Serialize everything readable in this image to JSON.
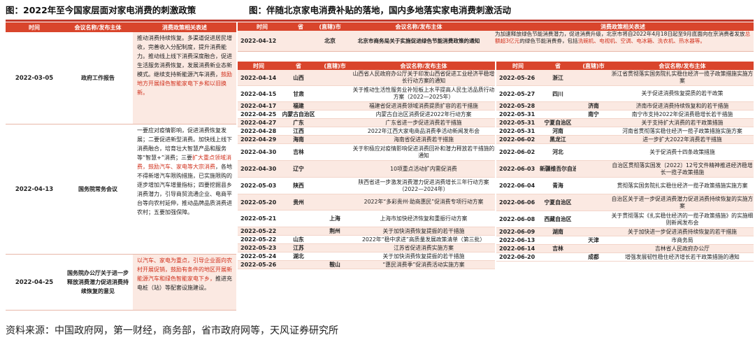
{
  "fig1_title": "图：2022年至今国家层面对家电消费的刺激政策",
  "fig2_title": "图：伴随北京家电消费补贴的落地，国内多地落实家电消费刺激活动",
  "left": {
    "headers": [
      "时间",
      "会议名称/发布主体",
      "消费政策相关表述"
    ],
    "rows": [
      {
        "date": "2022-03-05",
        "org": "政府工作报告",
        "text": "推动消费持续恢复。多渠道促进居民增收，完善收入分配制度，提升消费能力。推动线上线下消费深度融合，促进生活服务消费恢复，发展消费新业态新模式。继续支持新能源汽车消费，",
        "text_red": "鼓励地方开展绿色智能家电下乡和以旧换新。",
        "text_tail": ""
      },
      {
        "date": "2022-04-13",
        "org": "国务院常务会议",
        "text": "一要应对疫情影响，促进消费恢复发展；二要促进新型消费。加快线上线下消费融合，培育壮大智慧产品和服务等“智慧+”消费；三要",
        "text_red": "扩大重点领域消费，鼓励汽车、家电等大宗消费",
        "text_tail": "，各地不得新增汽车限购措施，已实施限购的逐步增加汽车增量指标；四要挖掘县乡消费潜力，引导商贸流通企业、电商平台等向农村延伸，推动品牌品质消费进农村；五要加强保障。"
      },
      {
        "date": "2022-04-25",
        "org": "国务院办公厅关于进一步释放消费潜力促进消费持续恢复的意见",
        "text": "",
        "text_red": "以汽车、家电为重点，引导企业面向农村开展促销，鼓励有条件的地区开展新能源汽车和绿色智能家电下乡，",
        "text_tail": "推进充电桩（站）等配套设施建设。"
      }
    ]
  },
  "right": {
    "top_headers": [
      "时间",
      "省",
      "(直辖)市",
      "会议名称/发布主体",
      "消费政策相关表述"
    ],
    "top_row": {
      "date": "2022-04-12",
      "city": "北京",
      "org": "北京市商务局关于实施促进绿色节能消费政策的通知",
      "text": "为加速释放绿色节能消费潜力，促进消费升级，北京市将自2022年4月18日起至9月底面向在京消费者发放",
      "text_red": "总额超3亿元",
      "text_mid": "的绿色节能消费券，包括",
      "text_red2": "洗碗机、电视机、空调、电冰箱、洗衣机、热水器等。",
      "text_tail": ""
    },
    "sub_headers": [
      "时间",
      "省",
      "(直辖)市",
      "会议名称/发布主体"
    ],
    "left_rows": [
      {
        "date": "2022-04-14",
        "prov": "山西",
        "city": "",
        "org": "山西省人民政府办公厅关于印发山西省促进工业经济平稳增长行动方案的通知"
      },
      {
        "date": "2022-04-15",
        "prov": "甘肃",
        "city": "",
        "org": "关于推动生活性服务业补短板上水平提高人民生活品质行动方案（2022—2025年）"
      },
      {
        "date": "2022-04-17",
        "prov": "福建",
        "city": "",
        "org": "福建省促进消费领域消费提质扩容的若干措施"
      },
      {
        "date": "2022-04-25",
        "prov": "内蒙古自治区",
        "city": "",
        "org": "内蒙古自治区消费促进2022年行动方案"
      },
      {
        "date": "2022-04-27",
        "prov": "广东",
        "city": "",
        "org": "广东省进一步促进消费若干措施"
      },
      {
        "date": "2022-04-28",
        "prov": "江西",
        "city": "",
        "org": "2022年江西大家电商品消费季活动新闻发布会"
      },
      {
        "date": "2022-04-29",
        "prov": "海南",
        "city": "",
        "org": "海南省促进消费若干措施"
      },
      {
        "date": "2022-04-30",
        "prov": "吉林",
        "city": "",
        "org": "关于积极应对疫情影响促进消费回补和潜力释放若干措施的通知"
      },
      {
        "date": "2022-04-30",
        "prov": "辽宁",
        "city": "",
        "org": "10项重点活动扩内需促消费"
      },
      {
        "date": "2022-05-03",
        "prov": "陕西",
        "city": "",
        "org": "陕西省进一步激发消费潜力促进消费增长三年行动方案（2022—2024年）"
      },
      {
        "date": "2022-05-20",
        "prov": "贵州",
        "city": "",
        "org": "2022年“多彩贵州·助商惠民”促消费专项行动方案"
      },
      {
        "date": "2022-05-21",
        "prov": "",
        "city": "上海",
        "org": "上海市加快经济恢复和重振行动方案"
      },
      {
        "date": "2022-05-22",
        "prov": "",
        "city": "荆州",
        "org": "关于加快消费恢复提振的若干措施"
      },
      {
        "date": "2022-05-22",
        "prov": "山东",
        "city": "",
        "org": "2022年“稳中求进”高质量发展政策清单（第三批）"
      },
      {
        "date": "2022-05-23",
        "prov": "江苏",
        "city": "",
        "org": "江苏省促进消费实施方案"
      },
      {
        "date": "2022-05-24",
        "prov": "湖北",
        "city": "",
        "org": "关于加快消费恢复提振的若干措施"
      },
      {
        "date": "2022-05-26",
        "prov": "",
        "city": "鞍山",
        "org": "“惠民消费季”促消费活动实施方案"
      }
    ],
    "right_rows": [
      {
        "date": "2022-05-26",
        "prov": "浙江",
        "city": "",
        "org": "浙江省贯彻落实国务院扎实稳住经济一揽子政策措施实施方案"
      },
      {
        "date": "2022-05-27",
        "prov": "四川",
        "city": "",
        "org": "关于促进消费恢复提质的若干政策"
      },
      {
        "date": "2022-05-28",
        "prov": "",
        "city": "济南",
        "org": "济南市促进消费持续恢复和的若干措施"
      },
      {
        "date": "2022-05-31",
        "prov": "",
        "city": "南宁",
        "org": "南宁市支持2022年促消费稳增长若干措施"
      },
      {
        "date": "2022-05-31",
        "prov": "宁夏自治区",
        "city": "",
        "org": "关于支持扩大消费的若干政策措施"
      },
      {
        "date": "2022-05-31",
        "prov": "河南",
        "city": "",
        "org": "河南省贯彻落实稳住经济一揽子政策措施实施方案"
      },
      {
        "date": "2022-06-02",
        "prov": "黑龙江",
        "city": "",
        "org": "进一步扩大2022年消费若干措施"
      },
      {
        "date": "2022-06-02",
        "prov": "河北",
        "city": "",
        "org": "关于促消费十四条政策措施"
      },
      {
        "date": "2022-06-03",
        "prov": "新疆维吾尔自治区",
        "city": "",
        "org": "自治区贯彻落实国发〔2022〕12号文件精神推进经济稳增长一揽子政策措施"
      },
      {
        "date": "2022-06-04",
        "prov": "青海",
        "city": "",
        "org": "贯彻落实国务院扎实稳住经济一揽子政策措施实施方案"
      },
      {
        "date": "2022-06-06",
        "prov": "宁夏自治区",
        "city": "",
        "org": "自治区关于进一步促进消费潜力促进消费持续恢复的实施方案"
      },
      {
        "date": "2022-06-08",
        "prov": "西藏自治区",
        "city": "",
        "org": "关于贯彻落实《扎实稳住经济的一揽子政策措施》的实施细则新闻发布会"
      },
      {
        "date": "2022-06-09",
        "prov": "湖南",
        "city": "",
        "org": "关于加快进一步促进消费持续恢复的若干措施"
      },
      {
        "date": "2022-06-13",
        "prov": "",
        "city": "天津",
        "org": "市商务局"
      },
      {
        "date": "2022-06-14",
        "prov": "吉林",
        "city": "",
        "org": "吉林省人民政府办公厅"
      },
      {
        "date": "2022-06-20",
        "prov": "",
        "city": "成都",
        "org": "增强发展韧性稳住经济增长若干政策措施的通知"
      }
    ]
  },
  "source": "资料来源：中国政府网，第一财经，商务部，省市政府网等，天风证券研究所"
}
